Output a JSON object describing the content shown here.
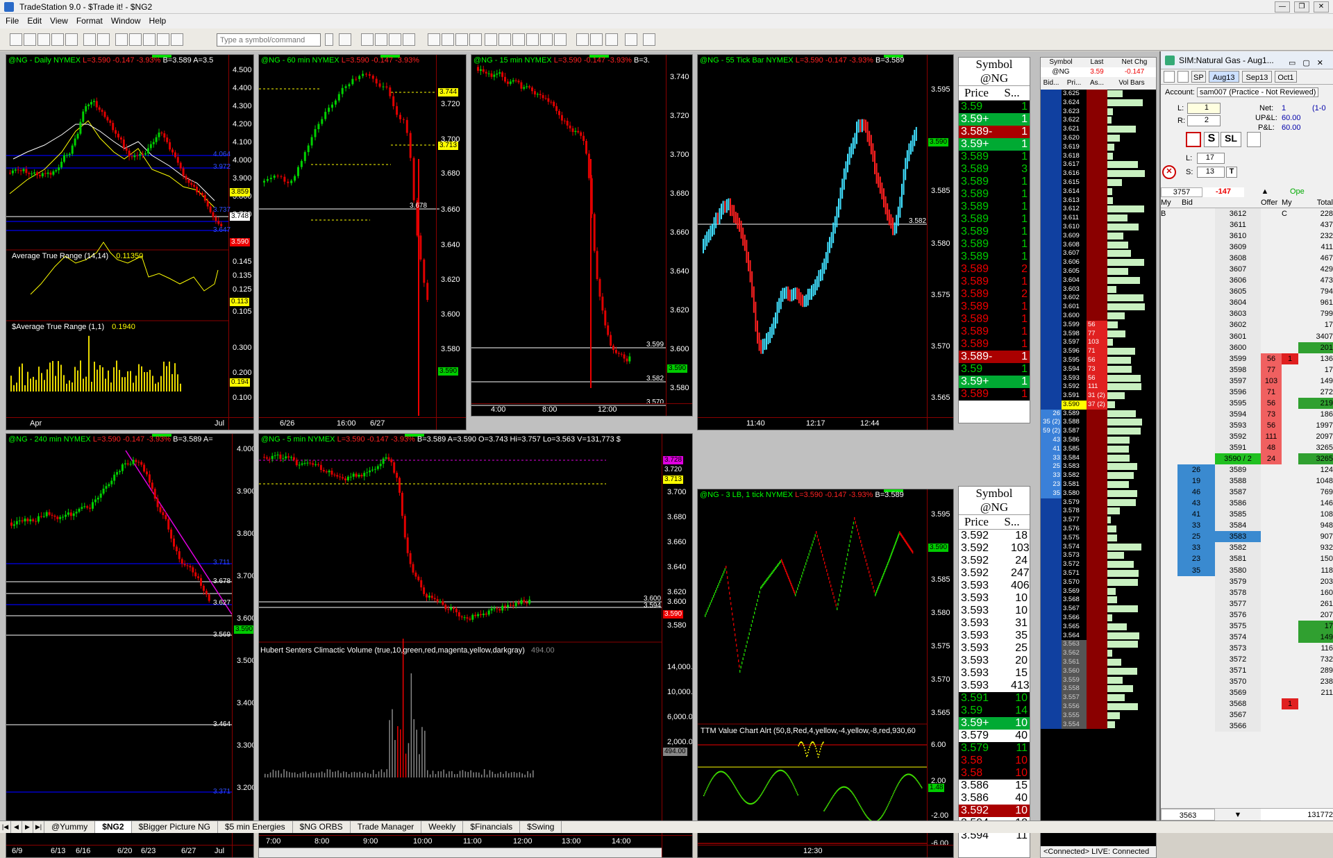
{
  "window": {
    "title": "TradeStation 9.0 - $Trade it! - $NG2",
    "buttons": [
      "—",
      "❐",
      "✕"
    ]
  },
  "menu": [
    "File",
    "Edit",
    "View",
    "Format",
    "Window",
    "Help"
  ],
  "toolbar": {
    "symbol_placeholder": "Type a symbol/command"
  },
  "charts": {
    "daily": {
      "title": "@NG - Daily  NYMEX",
      "last": "L=3.590",
      "chg": "-0.147",
      "pct": "-3.93%",
      "rest": "B=3.589  A=3.5",
      "y_labels": [
        "4.500",
        "4.400",
        "4.300",
        "4.200",
        "4.100",
        "4.000",
        "3.900",
        "3.800",
        "3.700"
      ],
      "tags": [
        "3.859",
        "3.748",
        "3.590"
      ],
      "blue_tags": [
        "4.064",
        "3.972",
        "3.737",
        "3.647"
      ],
      "atr_title": "Average True Range (14,14)",
      "atr_val": "0.11350",
      "atr_y": [
        "0.145",
        "0.135",
        "0.125",
        "0.115",
        "0.105"
      ],
      "atr_tag": "0.113",
      "satr_title": "$Average True Range (1,1)",
      "satr_val": "0.1940",
      "satr_y": [
        "0.300",
        "0.200",
        "0.100"
      ],
      "satr_tag": "0.194",
      "x_labels": [
        "Apr",
        "Jul"
      ]
    },
    "min60": {
      "title": "@NG - 60 min  NYMEX",
      "last": "L=3.590",
      "chg": "-0.147",
      "pct": "-3.93%",
      "y_labels": [
        "3.740",
        "3.720",
        "3.700",
        "3.680",
        "3.660",
        "3.640",
        "3.620",
        "3.600",
        "3.580"
      ],
      "tags": [
        "3.744",
        "3.713",
        "3.678",
        "3.590"
      ],
      "x_labels": [
        "6/26",
        "16:00",
        "6/27"
      ]
    },
    "min15": {
      "title": "@NG - 15 min  NYMEX",
      "last": "L=3.590",
      "chg": "-0.147",
      "pct": "-3.93%",
      "rest": "B=3.",
      "y_labels": [
        "3.740",
        "3.720",
        "3.700",
        "3.680",
        "3.660",
        "3.640",
        "3.620",
        "3.600",
        "3.580"
      ],
      "tags": [
        "3.599",
        "3.582",
        "3.570",
        "3.590"
      ],
      "x_labels": [
        "4:00",
        "8:00",
        "12:00"
      ]
    },
    "tick55": {
      "title": "@NG - 55 Tick Bar  NYMEX",
      "last": "L=3.590",
      "chg": "-0.147",
      "pct": "-3.93%",
      "rest": "B=3.589",
      "y_labels": [
        "3.595",
        "3.590",
        "3.585",
        "3.580",
        "3.575",
        "3.570",
        "3.565"
      ],
      "tags": [
        "3.582"
      ],
      "tag_green": "3.590",
      "x_labels": [
        "11:40",
        "12:17",
        "12:44"
      ]
    },
    "min240": {
      "title": "@NG - 240 min  NYMEX",
      "last": "L=3.590",
      "chg": "-0.147",
      "pct": "-3.93%",
      "rest": "B=3.589  A=",
      "y_labels": [
        "4.000",
        "3.900",
        "3.800",
        "3.700",
        "3.600",
        "3.500",
        "3.400",
        "3.300",
        "3.200"
      ],
      "tags": [
        "3.678",
        "3.627",
        "3.569",
        "3.464",
        "3.590"
      ],
      "blue_tags": [
        "3.711",
        "3.371"
      ],
      "x_labels": [
        "6/9",
        "6/13",
        "6/16",
        "6/20",
        "6/23",
        "6/27",
        "Jul"
      ]
    },
    "min5": {
      "title": "@NG - 5 min  NYMEX",
      "last": "L=3.590",
      "chg": "-0.147",
      "pct": "-3.93%",
      "rest": "B=3.589  A=3.590  O=3.743  Hi=3.757  Lo=3.563  V=131,773  $",
      "y_labels": [
        "3.700",
        "3.680",
        "3.660",
        "3.640",
        "3.620",
        "3.600",
        "3.580"
      ],
      "tags": [
        "3.728",
        "3.720",
        "3.713",
        "3.600",
        "3.594",
        "3.590"
      ],
      "vol_title": "Hubert Senters Climactic Volume (true,10,green,red,magenta,yellow,darkgray)",
      "vol_val": "494.00",
      "vol_y": [
        "14,000.00",
        "10,000.00",
        "6,000.00",
        "2,000.00"
      ],
      "vol_tag": "494.00",
      "x_labels": [
        "7:00",
        "8:00",
        "9:00",
        "10:00",
        "11:00",
        "12:00",
        "13:00",
        "14:00"
      ]
    },
    "lb3": {
      "title": "@NG - 3 LB, 1 tick  NYMEX",
      "last": "L=3.590",
      "chg": "-0.147",
      "pct": "-3.93%",
      "rest": "B=3.589",
      "y_labels": [
        "3.595",
        "3.590",
        "3.585",
        "3.580",
        "3.575",
        "3.570",
        "3.565"
      ],
      "tag_green": "3.590",
      "ttm_title": "TTM Value Chart Alrt (50,8,Red,4,yellow,-4,yellow,-8,red,930,60",
      "ttm_y": [
        "6.00",
        "2.00",
        "-2.00",
        "-6.00"
      ],
      "ttm_tag": "1.48",
      "x_labels": [
        "12:30"
      ]
    }
  },
  "ts1": {
    "symbol": "Symbol",
    "sym": "@NG",
    "col_price": "Price",
    "col_size": "S...",
    "rows": [
      [
        "3.59",
        "1",
        "g"
      ],
      [
        "3.59+",
        "1",
        "G"
      ],
      [
        "3.589-",
        "1",
        "R"
      ],
      [
        "3.59+",
        "1",
        "G"
      ],
      [
        "3.589",
        "1",
        "g"
      ],
      [
        "3.589",
        "3",
        "g"
      ],
      [
        "3.589",
        "1",
        "g"
      ],
      [
        "3.589",
        "1",
        "g"
      ],
      [
        "3.589",
        "1",
        "g"
      ],
      [
        "3.589",
        "1",
        "g"
      ],
      [
        "3.589",
        "1",
        "g"
      ],
      [
        "3.589",
        "1",
        "g"
      ],
      [
        "3.589",
        "1",
        "g"
      ],
      [
        "3.589",
        "2",
        "r"
      ],
      [
        "3.589",
        "1",
        "r"
      ],
      [
        "3.589",
        "2",
        "r"
      ],
      [
        "3.589",
        "1",
        "r"
      ],
      [
        "3.589",
        "1",
        "r"
      ],
      [
        "3.589",
        "1",
        "r"
      ],
      [
        "3.589",
        "1",
        "r"
      ],
      [
        "3.589-",
        "1",
        "R"
      ],
      [
        "3.59",
        "1",
        "g"
      ],
      [
        "3.59+",
        "1",
        "G"
      ],
      [
        "3.589",
        "1",
        "r"
      ]
    ]
  },
  "ts2": {
    "symbol": "Symbol",
    "sym": "@NG",
    "col_price": "Price",
    "col_size": "S...",
    "rows": [
      [
        "3.592",
        "18",
        "w"
      ],
      [
        "3.592",
        "103",
        "w"
      ],
      [
        "3.592",
        "24",
        "w"
      ],
      [
        "3.592",
        "247",
        "w"
      ],
      [
        "3.593",
        "406",
        "w"
      ],
      [
        "3.593",
        "10",
        "w"
      ],
      [
        "3.593",
        "10",
        "w"
      ],
      [
        "3.593",
        "31",
        "w"
      ],
      [
        "3.593",
        "35",
        "w"
      ],
      [
        "3.593",
        "25",
        "w"
      ],
      [
        "3.593",
        "20",
        "w"
      ],
      [
        "3.593",
        "15",
        "w"
      ],
      [
        "3.593",
        "413",
        "w"
      ],
      [
        "3.591",
        "10",
        "g"
      ],
      [
        "3.59",
        "14",
        "g"
      ],
      [
        "3.59+",
        "10",
        "G"
      ],
      [
        "3.579",
        "40",
        "w"
      ],
      [
        "3.579",
        "11",
        "g"
      ],
      [
        "3.58",
        "10",
        "r"
      ],
      [
        "3.58",
        "10",
        "r"
      ],
      [
        "3.586",
        "15",
        "w"
      ],
      [
        "3.586",
        "40",
        "w"
      ],
      [
        "3.592",
        "10",
        "R"
      ],
      [
        "3.594",
        "12",
        "w"
      ],
      [
        "3.594",
        "11",
        "w"
      ]
    ]
  },
  "matrix": {
    "cols": [
      "Symbol",
      "Last",
      "Net Chg"
    ],
    "symbol": "@NG",
    "last": "3.59",
    "netchg": "-0.147",
    "subcols": [
      "Bid...",
      "Pri...",
      "As...",
      "Vol Bars"
    ],
    "bids": [
      [
        "26",
        "3.589"
      ],
      [
        "35 (2)",
        "3.588"
      ],
      [
        "59 (2)",
        "3.587"
      ],
      [
        "43",
        "3.586"
      ],
      [
        "41",
        "3.585"
      ],
      [
        "33",
        "3.584"
      ],
      [
        "25",
        "3.583"
      ],
      [
        "33",
        "3.582"
      ],
      [
        "23",
        "3.581"
      ],
      [
        "35",
        "3.580"
      ]
    ],
    "asks": [
      [
        "3.599",
        "56"
      ],
      [
        "3.598",
        "77"
      ],
      [
        "3.597",
        "103"
      ],
      [
        "3.596",
        "71"
      ],
      [
        "3.595",
        "56"
      ],
      [
        "3.594",
        "73"
      ],
      [
        "3.593",
        "56"
      ],
      [
        "3.592",
        "111"
      ],
      [
        "3.591",
        "31 (2)"
      ],
      [
        "3.590",
        "37 (2)"
      ]
    ],
    "status": "<Connected> LIVE: Connected"
  },
  "order": {
    "title": "SIM:Natural Gas - Aug1...",
    "account_label": "Account:",
    "account": "sam007 (Practice - Not Reviewed)",
    "months": [
      "Aug13",
      "Sep13",
      "Oct1"
    ],
    "type": "SP",
    "L_label": "L:",
    "R_label": "R:",
    "L": "1",
    "R": "2",
    "net_label": "Net:",
    "net": "1",
    "net2": "(1-0",
    "upl_label": "UP&L:",
    "upl": "60.00",
    "pl_label": "P&L:",
    "pl": "60.00",
    "L2_label": "L:",
    "L2": "17",
    "S_label": "S:",
    "S": "13",
    "btn_s": "S",
    "btn_sl": "SL",
    "btn_t": "T",
    "price_box": "3757",
    "net_big": "-147",
    "open_label": "Ope",
    "dom_cols": [
      "My B",
      "Bid",
      "",
      "Offer",
      "My C",
      "Total"
    ],
    "last_row": "3590 / 2",
    "last_vol": "3265",
    "bottom_price": "3563",
    "bottom_total": "131772"
  },
  "tabs": [
    "@Yummy",
    "$NG2",
    "$Bigger Picture NG",
    "$5 min Energies",
    "$NG ORBS",
    "Trade Manager",
    "Weekly",
    "$Financials",
    "$Swing"
  ]
}
